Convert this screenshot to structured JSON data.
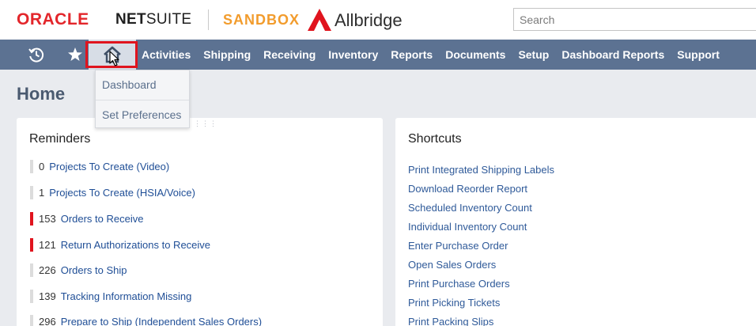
{
  "header": {
    "brand_oracle": "ORACLE",
    "brand_netsuite_prefix": "NET",
    "brand_netsuite_suffix": "SUITE",
    "sandbox": "SANDBOX",
    "company": "Allbridge",
    "search_placeholder": "Search"
  },
  "nav": {
    "recent_icon": "history-icon",
    "favorites_icon": "star-icon",
    "home_icon": "home-icon",
    "items": [
      "Activities",
      "Shipping",
      "Receiving",
      "Inventory",
      "Reports",
      "Documents",
      "Setup",
      "Dashboard Reports",
      "Support"
    ]
  },
  "home_menu": {
    "items": [
      "Dashboard",
      "Set Preferences"
    ]
  },
  "page": {
    "title": "Home"
  },
  "reminders": {
    "title": "Reminders",
    "items": [
      {
        "count": "0",
        "label": "Projects To Create (Video)",
        "flag": "none"
      },
      {
        "count": "1",
        "label": "Projects To Create (HSIA/Voice)",
        "flag": "none"
      },
      {
        "count": "153",
        "label": "Orders to Receive",
        "flag": "red"
      },
      {
        "count": "121",
        "label": "Return Authorizations to Receive",
        "flag": "red"
      },
      {
        "count": "226",
        "label": "Orders to Ship",
        "flag": "none"
      },
      {
        "count": "139",
        "label": "Tracking Information Missing",
        "flag": "none"
      },
      {
        "count": "296",
        "label": "Prepare to Ship (Independent Sales Orders)",
        "flag": "none"
      }
    ]
  },
  "shortcuts": {
    "title": "Shortcuts",
    "items": [
      "Print Integrated Shipping Labels",
      "Download Reorder Report",
      "Scheduled Inventory Count",
      "Individual Inventory Count",
      "Enter Purchase Order",
      "Open Sales Orders",
      "Print Purchase Orders",
      "Print Picking Tickets",
      "Print Packing Slips"
    ]
  },
  "colors": {
    "nav_background": "#5c7292",
    "highlight_red": "#e0141e",
    "oracle_red": "#e3262b",
    "sandbox_orange": "#f29c2d",
    "link_blue": "#1f4e96"
  }
}
